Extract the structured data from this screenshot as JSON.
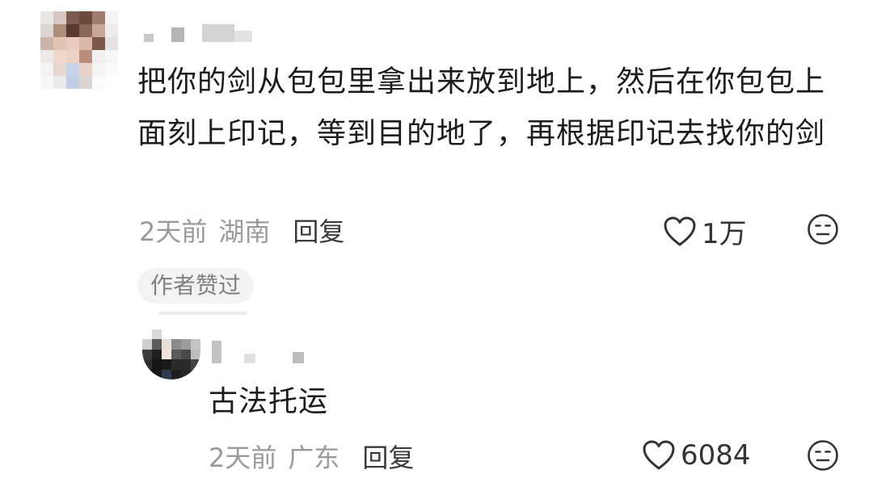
{
  "comment": {
    "avatar_icon": "user-avatar-pixelated",
    "text": "把你的剑从包包里拿出来放到地上，然后在你包包上面刻上印记，等到目的地了，再根据印记去找你的剑",
    "time": "2天前",
    "location": "湖南",
    "reply_label": "回复",
    "like_icon": "heart-outline-icon",
    "like_count": "1万",
    "dislike_icon": "meh-face-icon",
    "badge": "作者赞过"
  },
  "reply": {
    "avatar_icon": "user-avatar-pixelated",
    "text": "古法托运",
    "time": "2天前",
    "location": "广东",
    "reply_label": "回复",
    "like_icon": "heart-outline-icon",
    "like_count": "6084",
    "dislike_icon": "meh-face-icon"
  },
  "colors": {
    "text_primary": "#1c1c1c",
    "text_secondary": "#9a9a9a",
    "badge_bg": "#f3f3f3"
  }
}
